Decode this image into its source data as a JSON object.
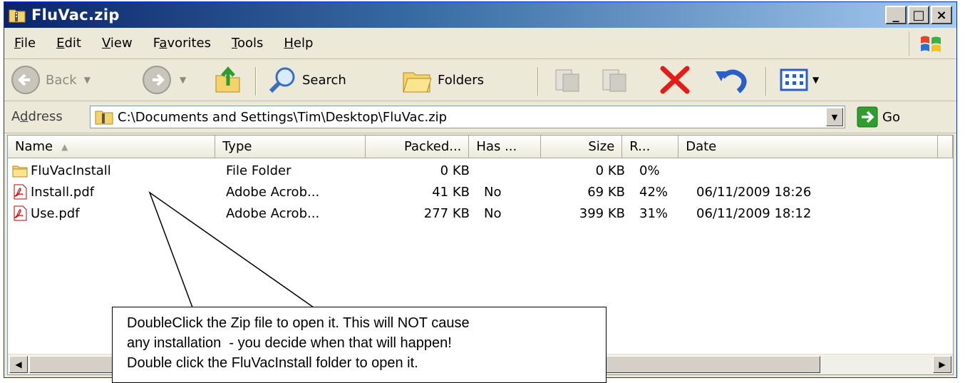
{
  "window": {
    "title": "FluVac.zip",
    "minimize": "_",
    "maximize": "□",
    "close": "×"
  },
  "menu": {
    "items": [
      {
        "key": "file",
        "pre": "",
        "u": "F",
        "post": "ile"
      },
      {
        "key": "edit",
        "pre": "",
        "u": "E",
        "post": "dit"
      },
      {
        "key": "view",
        "pre": "",
        "u": "V",
        "post": "iew"
      },
      {
        "key": "favorites",
        "pre": "F",
        "u": "a",
        "post": "vorites"
      },
      {
        "key": "tools",
        "pre": "",
        "u": "T",
        "post": "ools"
      },
      {
        "key": "help",
        "pre": "",
        "u": "H",
        "post": "elp"
      }
    ]
  },
  "toolbar": {
    "back": "Back",
    "search": "Search",
    "folders": "Folders"
  },
  "address": {
    "label_pre": "A",
    "label_u": "d",
    "label_post": "dress",
    "path": "C:\\Documents and Settings\\Tim\\Desktop\\FluVac.zip",
    "go": "Go"
  },
  "list": {
    "columns": [
      "Name",
      "Type",
      "Packed...",
      "Has ...",
      "Size",
      "R...",
      "Date"
    ],
    "rows": [
      {
        "icon": "folder-icon",
        "name": "FluVacInstall",
        "type": "File Folder",
        "packed": "0 KB",
        "has": "",
        "size": "0 KB",
        "ratio": "0%",
        "date": ""
      },
      {
        "icon": "pdf-icon",
        "name": "Install.pdf",
        "type": "Adobe Acrob...",
        "packed": "41 KB",
        "has": "No",
        "size": "69 KB",
        "ratio": "42%",
        "date": "06/11/2009 18:26"
      },
      {
        "icon": "pdf-icon",
        "name": "Use.pdf",
        "type": "Adobe Acrob...",
        "packed": "277 KB",
        "has": "No",
        "size": "399 KB",
        "ratio": "31%",
        "date": "06/11/2009 18:12"
      }
    ]
  },
  "callout": {
    "line1": "DoubleClick the Zip file to open it. This will NOT cause",
    "line2": "any installation  - you decide when that will happen!",
    "line3": "Double click the FluVacInstall folder to open it."
  },
  "colors": {
    "titlebar_start": "#0a246a",
    "titlebar_end": "#a6caf0",
    "chrome": "#ece9d8",
    "go_green": "#2f9e2f",
    "delete_red": "#e41b17"
  }
}
